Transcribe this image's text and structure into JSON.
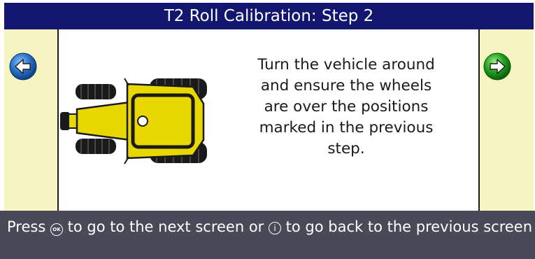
{
  "title": "T2 Roll Calibration: Step 2",
  "instruction": "Turn the vehicle around\nand ensure the wheels\nare over the positions\nmarked in the previous\nstep.",
  "footer": {
    "part1": "Press ",
    "ok_glyph": "OK",
    "part2": " to go to the next screen or ",
    "back_glyph": "i",
    "part3": " to go back to the previous screen"
  },
  "icons": {
    "prev": "arrow-left-icon",
    "next": "arrow-right-icon",
    "vehicle": "tractor-top-view-icon"
  },
  "colors": {
    "title_bar": "#12166e",
    "side_panel": "#f6f5c2",
    "footer": "#484a57",
    "prev_button": "#2a73c8",
    "next_button": "#1fa31f",
    "vehicle_body": "#e8d800"
  }
}
